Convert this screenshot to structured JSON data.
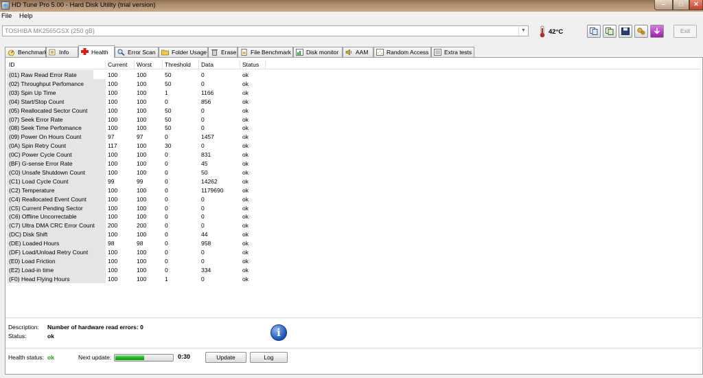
{
  "window": {
    "title": "HD Tune Pro 5.00 - Hard Disk Utility (trial version)"
  },
  "menu": [
    {
      "label": "File"
    },
    {
      "label": "Help"
    }
  ],
  "toolbar": {
    "drive": "TOSHIBA MK2565GSX (250 gB)",
    "temperature": "42°C",
    "exit_label": "Exit",
    "buttons": [
      "copy-text-icon",
      "copy-screenshot-icon",
      "save-icon",
      "options-icon",
      "download-icon"
    ]
  },
  "tabs": [
    {
      "label": "Benchmark",
      "icon": "benchmark-icon"
    },
    {
      "label": "Info",
      "icon": "info-icon"
    },
    {
      "label": "Health",
      "icon": "health-cross-icon",
      "active": true
    },
    {
      "label": "Error Scan",
      "icon": "magnifier-icon"
    },
    {
      "label": "Folder Usage",
      "icon": "folder-icon"
    },
    {
      "label": "Erase",
      "icon": "trash-icon"
    },
    {
      "label": "File Benchmark",
      "icon": "file-benchmark-icon"
    },
    {
      "label": "Disk monitor",
      "icon": "disk-monitor-icon"
    },
    {
      "label": "AAM",
      "icon": "speaker-icon"
    },
    {
      "label": "Random Access",
      "icon": "random-access-icon"
    },
    {
      "label": "Extra tests",
      "icon": "extra-tests-icon"
    }
  ],
  "table": {
    "columns": [
      "ID",
      "Current",
      "Worst",
      "Threshold",
      "Data",
      "Status"
    ],
    "rows": [
      [
        "(01) Raw Read Error Rate",
        "100",
        "100",
        "50",
        "0",
        "ok"
      ],
      [
        "(02) Throughput Perfomance",
        "100",
        "100",
        "50",
        "0",
        "ok"
      ],
      [
        "(03) Spin Up Time",
        "100",
        "100",
        "1",
        "1166",
        "ok"
      ],
      [
        "(04) Start/Stop Count",
        "100",
        "100",
        "0",
        "856",
        "ok"
      ],
      [
        "(05) Reallocated Sector Count",
        "100",
        "100",
        "50",
        "0",
        "ok"
      ],
      [
        "(07) Seek Error Rate",
        "100",
        "100",
        "50",
        "0",
        "ok"
      ],
      [
        "(08) Seek Time Perfomance",
        "100",
        "100",
        "50",
        "0",
        "ok"
      ],
      [
        "(09) Power On Hours Count",
        "97",
        "97",
        "0",
        "1457",
        "ok"
      ],
      [
        "(0A) Spin Retry Count",
        "117",
        "100",
        "30",
        "0",
        "ok"
      ],
      [
        "(0C) Power Cycle Count",
        "100",
        "100",
        "0",
        "831",
        "ok"
      ],
      [
        "(BF) G-sense Error Rate",
        "100",
        "100",
        "0",
        "45",
        "ok"
      ],
      [
        "(C0) Unsafe Shutdown Count",
        "100",
        "100",
        "0",
        "50",
        "ok"
      ],
      [
        "(C1) Load Cycle Count",
        "99",
        "99",
        "0",
        "14262",
        "ok"
      ],
      [
        "(C2) Temperature",
        "100",
        "100",
        "0",
        "1179690",
        "ok"
      ],
      [
        "(C4) Reallocated Event Count",
        "100",
        "100",
        "0",
        "0",
        "ok"
      ],
      [
        "(C5) Current Pending Sector",
        "100",
        "100",
        "0",
        "0",
        "ok"
      ],
      [
        "(C6) Offline Uncorrectable",
        "100",
        "100",
        "0",
        "0",
        "ok"
      ],
      [
        "(C7) Ultra DMA CRC Error Count",
        "200",
        "200",
        "0",
        "0",
        "ok"
      ],
      [
        "(DC) Disk Shift",
        "100",
        "100",
        "0",
        "44",
        "ok"
      ],
      [
        "(DE) Loaded Hours",
        "98",
        "98",
        "0",
        "958",
        "ok"
      ],
      [
        "(DF) Load/Unload Retry Count",
        "100",
        "100",
        "0",
        "0",
        "ok"
      ],
      [
        "(E0) Load Friction",
        "100",
        "100",
        "0",
        "0",
        "ok"
      ],
      [
        "(E2) Load-in time",
        "100",
        "100",
        "0",
        "334",
        "ok"
      ],
      [
        "(F0) Head Flying Hours",
        "100",
        "100",
        "1",
        "0",
        "ok"
      ]
    ]
  },
  "details": {
    "description_label": "Description:",
    "description_value": "Number of hardware read errors: 0",
    "status_label": "Status:",
    "status_value": "ok"
  },
  "footer": {
    "health_label": "Health status:",
    "health_value": "ok",
    "health_color": "#16a016",
    "next_update_label": "Next update:",
    "countdown": "0:30",
    "progress_fraction": 0.5,
    "update_button": "Update",
    "log_button": "Log"
  }
}
